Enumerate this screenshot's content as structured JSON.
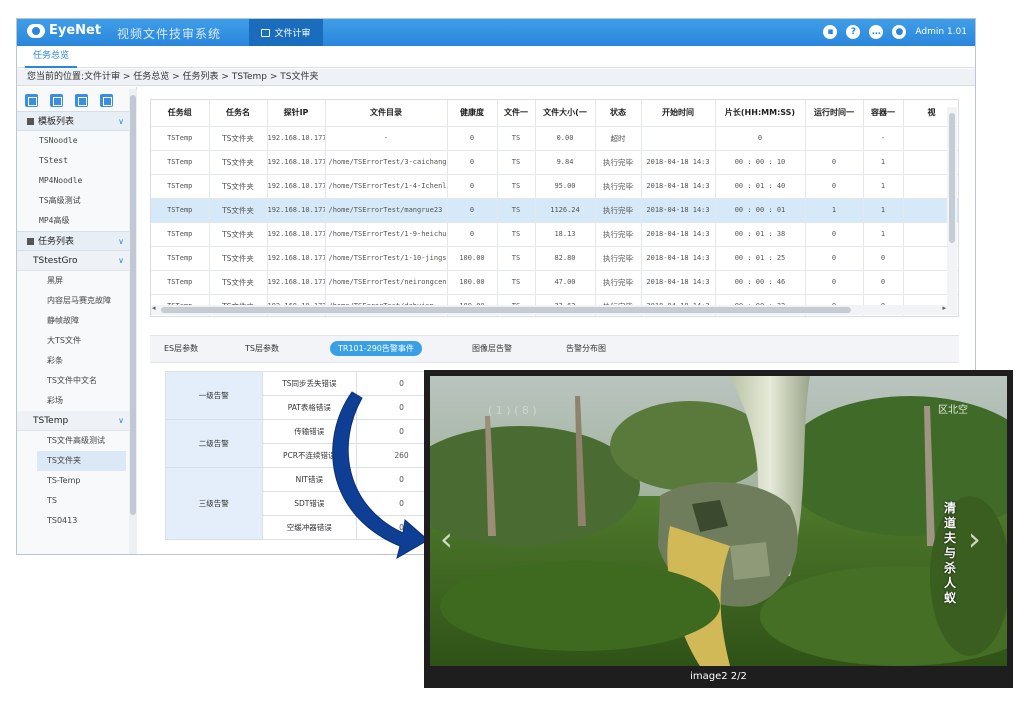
{
  "app": {
    "brand": "EyeNet",
    "system_title": "视频文件技审系统",
    "module_tab": "文件计审",
    "user_label": "Admin 1.01",
    "top_icons": [
      "display-icon",
      "help-icon",
      "chat-icon",
      "user-icon"
    ]
  },
  "subtab": "任务总览",
  "breadcrumb": "您当前的位置:文件计审 > 任务总览 > 任务列表 > TSTemp > TS文件夹",
  "sidebar": {
    "template_group": "模板列表",
    "template_items": [
      "TSNoodle",
      "TStest",
      "MP4Noodle",
      "TS高级测试",
      "MP4高级"
    ],
    "task_group": "任务列表",
    "task_sub1": "TStestGro",
    "task_sub1_items": [
      "黑屏",
      "内容层马赛克故障",
      "静帧故障",
      "大TS文件",
      "彩条",
      "TS文件中文名",
      "彩场"
    ],
    "task_sub2": "TSTemp",
    "task_sub2_items": [
      "TS文件高级测试",
      "TS文件夹",
      "TS-Temp",
      "TS",
      "TS0413"
    ]
  },
  "task_table": {
    "headers": [
      "任务组",
      "任务名",
      "探针IP",
      "文件目录",
      "健康度",
      "文件一",
      "文件大小(一",
      "状态",
      "开始时间",
      "片长(HH:MM:SS)",
      "运行时间一",
      "容器一",
      "视"
    ],
    "rows": [
      [
        "TSTemp",
        "TS文件夹",
        "192.168.10.177",
        "-",
        "0",
        "TS",
        "0.00",
        "超时",
        "",
        "0",
        "",
        "-",
        ""
      ],
      [
        "TSTemp",
        "TS文件夹",
        "192.168.10.177",
        "/home/TSErrorTest/3-caichang",
        "0",
        "TS",
        "9.84",
        "执行完毕",
        "2018-04-18 14:3",
        "00 : 00 : 10",
        "0",
        "1",
        ""
      ],
      [
        "TSTemp",
        "TS文件夹",
        "192.168.10.177",
        "/home/TSErrorTest/1-4-Ichenl",
        "0",
        "TS",
        "95.00",
        "执行完毕",
        "2018-04-18 14:3",
        "00 : 01 : 40",
        "0",
        "1",
        ""
      ],
      [
        "TSTemp",
        "TS文件夹",
        "192.168.10.177",
        "/home/TSErrorTest/mangrue23",
        "0",
        "TS",
        "1126.24",
        "执行完毕",
        "2018-04-18 14:3",
        "00 : 00 : 01",
        "1",
        "1",
        ""
      ],
      [
        "TSTemp",
        "TS文件夹",
        "192.168.10.177",
        "/home/TSErrorTest/1-9-heichu",
        "0",
        "TS",
        "18.13",
        "执行完毕",
        "2018-04-18 14:3",
        "00 : 01 : 38",
        "0",
        "1",
        ""
      ],
      [
        "TSTemp",
        "TS文件夹",
        "192.168.10.177",
        "/home/TSErrorTest/1-10-jings",
        "100.00",
        "TS",
        "82.80",
        "执行完毕",
        "2018-04-18 14:3",
        "00 : 01 : 25",
        "0",
        "0",
        ""
      ],
      [
        "TSTemp",
        "TS文件夹",
        "192.168.10.177",
        "/home/TSErrorTest/neirongcen",
        "100.00",
        "TS",
        "47.00",
        "执行完毕",
        "2018-04-18 14:3",
        "00 : 00 : 46",
        "0",
        "0",
        ""
      ],
      [
        "TSTemp",
        "TS文件夹",
        "192.168.10.177",
        "/home/TSErrorTest/dahuisp",
        "100.00",
        "TS",
        "33.62",
        "执行完毕",
        "2018-04-18 14:3",
        "00 : 00 : 32",
        "0",
        "0",
        ""
      ]
    ]
  },
  "detail_tabs": [
    "ES层参数",
    "TS层参数",
    "TR101-290告警事件",
    "图像层告警",
    "告警分布图"
  ],
  "alarms": {
    "level1": "一级告警",
    "level2": "二级告警",
    "level3": "三级告警",
    "items": [
      {
        "name": "TS同步丢失错误",
        "value": "0"
      },
      {
        "name": "PAT表格错误",
        "value": "0"
      },
      {
        "name": "传输错误",
        "value": "0"
      },
      {
        "name": "PCR不连续错误",
        "value": "260"
      },
      {
        "name": "NIT错误",
        "value": "0"
      },
      {
        "name": "SDT错误",
        "value": "0"
      },
      {
        "name": "空缓冲器错误",
        "value": "0"
      }
    ]
  },
  "viewer": {
    "caption": "image2   2/2",
    "overlay_title": "清道夫与杀人蚁",
    "overlay_top": "区北空",
    "overlay_faint": "( 1 ) ( 8 )",
    "prev": "‹",
    "next": "›"
  }
}
